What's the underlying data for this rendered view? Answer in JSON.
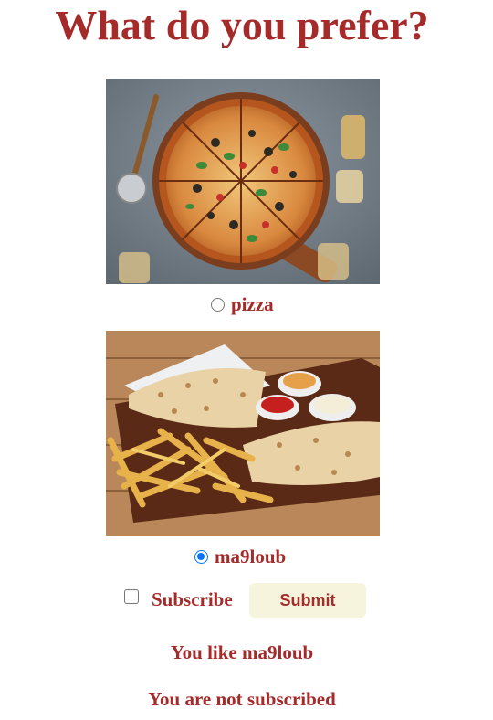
{
  "page": {
    "title": "What do you prefer?"
  },
  "options": [
    {
      "label": "pizza",
      "image": "pizza-photo",
      "checked": false
    },
    {
      "label": "ma9loub",
      "image": "ma9loub-photo",
      "checked": true
    }
  ],
  "subscribe": {
    "label": "Subscribe",
    "checked": false
  },
  "submit": {
    "label": "Submit"
  },
  "results": {
    "preference": "You like ma9loub",
    "subscription": "You are not subscribed"
  },
  "colors": {
    "text": "#a52a2a",
    "button_bg": "#f6f4dc",
    "radio_accent": "#0075ff"
  }
}
